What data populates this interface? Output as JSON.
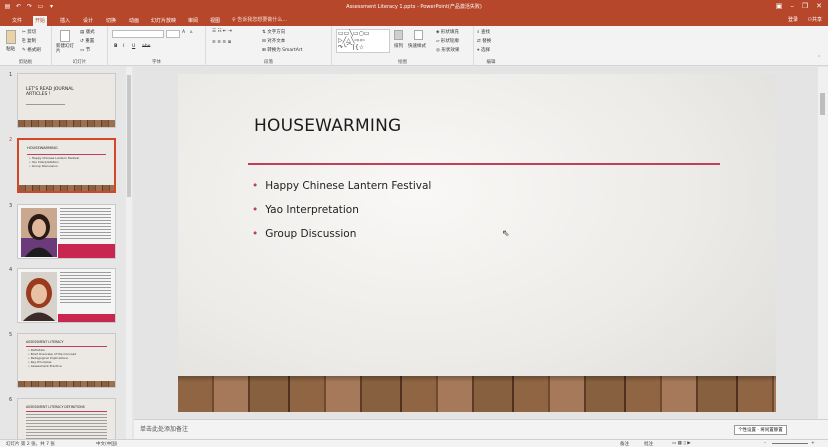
{
  "window": {
    "title": "Assessment Literacy 1.pptx - PowerPoint(产品激活失败)"
  },
  "ribbon_tabs": [
    {
      "label": "文件"
    },
    {
      "label": "开始"
    },
    {
      "label": "插入"
    },
    {
      "label": "设计"
    },
    {
      "label": "切换"
    },
    {
      "label": "动画"
    },
    {
      "label": "幻灯片放映"
    },
    {
      "label": "审阅"
    },
    {
      "label": "视图"
    }
  ],
  "tell_me": "告诉我您想要做什么...",
  "account": "登录",
  "share": "共享",
  "ribbon": {
    "clipboard": {
      "label": "剪贴板",
      "paste": "粘贴",
      "cut": "剪切",
      "copy": "复制",
      "format_painter": "格式刷"
    },
    "slides": {
      "label": "幻灯片",
      "new_slide": "新建幻灯片",
      "layout": "版式",
      "reset": "重置",
      "section": "节"
    },
    "font": {
      "label": "字体",
      "bold": "B",
      "italic": "I",
      "underline": "U",
      "strike": "abe",
      "size_up": "A",
      "size_down": "A"
    },
    "paragraph": {
      "label": "段落",
      "text_direction": "文字方向",
      "align_text": "对齐文本",
      "smartart": "转换为 SmartArt"
    },
    "drawing": {
      "label": "绘图",
      "arrange": "排列",
      "quick_styles": "快速样式",
      "shape_fill": "形状填充",
      "shape_outline": "形状轮廓",
      "shape_effects": "形状效果"
    },
    "editing": {
      "label": "编辑",
      "find": "查找",
      "replace": "替换",
      "select": "选择"
    }
  },
  "thumbnails": [
    {
      "num": "1",
      "title": "LET'S READ JOURNAL ARTICLES !"
    },
    {
      "num": "2",
      "title": "HOUSEWARMING",
      "bullets": [
        "Happy Chinese Lantern Festival",
        "Yao Interpretation",
        "Group Discussion"
      ]
    },
    {
      "num": "3"
    },
    {
      "num": "4"
    },
    {
      "num": "5",
      "title": "ASSESSMENT LITERACY",
      "bullets": [
        "Definition",
        "Brief Overview of the Concept",
        "Pedagogical Implications",
        "Key Principles",
        "Assessment Practice"
      ]
    },
    {
      "num": "6",
      "title": "ASSESSMENT LITERACY DEFINITIONS"
    }
  ],
  "slide": {
    "title": "HOUSEWARMING",
    "bullets": [
      "Happy Chinese Lantern Festival",
      "Yao Interpretation",
      "Group Discussion"
    ]
  },
  "notes_placeholder": "单击此处添加备注",
  "tooltip": "个性设置 · 将闲置静置",
  "status": {
    "slide_info": "幻灯片 第 2 张，共 7 张",
    "language": "中文(中国)",
    "notes": "备注",
    "comments": "批注",
    "zoom": "+"
  },
  "colors": {
    "accent": "#b7472a",
    "title_rule": "#c0405a",
    "selected_thumb": "#d24726"
  }
}
